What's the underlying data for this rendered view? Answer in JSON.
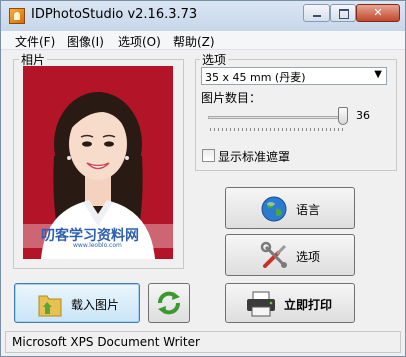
{
  "window": {
    "title": "IDPhotoStudio v2.16.3.73"
  },
  "menu": [
    {
      "label": "文件(F)"
    },
    {
      "label": "图像(I)"
    },
    {
      "label": "选项(O)"
    },
    {
      "label": "帮助(Z)"
    }
  ],
  "photo_group": {
    "label": "相片",
    "watermark": "叨客学习资料网",
    "watermark_sub": "www.leoblo.com"
  },
  "options_group": {
    "label": "选项",
    "size_select": {
      "value": "35 x 45 mm (丹麦)"
    },
    "count_label": "图片数目：",
    "count": {
      "value": "36",
      "min": 1,
      "max": 36,
      "current": 36
    },
    "show_mask_label": "显示标准遮罩",
    "show_mask_checked": false
  },
  "buttons": {
    "language": "语言",
    "options": "选项",
    "load_image": "载入图片",
    "print_now": "立即打印"
  },
  "status": {
    "printer": "Microsoft XPS Document Writer"
  },
  "colors": {
    "photo_background": "#b31427",
    "accent": "#3c7fb1"
  }
}
